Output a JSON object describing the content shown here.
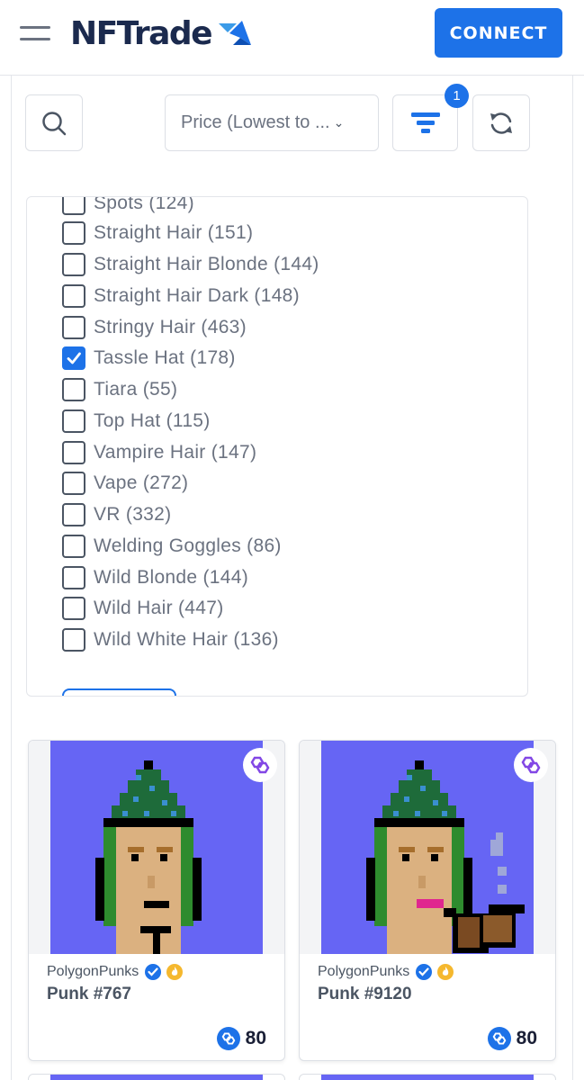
{
  "header": {
    "logo_text": "NFTrade",
    "connect_label": "CONNECT"
  },
  "toolbar": {
    "sort_label": "Price (Lowest to ...",
    "filter_badge": "1"
  },
  "filters": [
    {
      "label": "Spots (124)",
      "checked": false
    },
    {
      "label": "Straight Hair (151)",
      "checked": false
    },
    {
      "label": "Straight Hair Blonde (144)",
      "checked": false
    },
    {
      "label": "Straight Hair Dark (148)",
      "checked": false
    },
    {
      "label": "Stringy Hair (463)",
      "checked": false
    },
    {
      "label": "Tassle Hat (178)",
      "checked": true
    },
    {
      "label": "Tiara (55)",
      "checked": false
    },
    {
      "label": "Top Hat (115)",
      "checked": false
    },
    {
      "label": "Vampire Hair (147)",
      "checked": false
    },
    {
      "label": "Vape (272)",
      "checked": false
    },
    {
      "label": "VR (332)",
      "checked": false
    },
    {
      "label": "Welding Goggles (86)",
      "checked": false
    },
    {
      "label": "Wild Blonde (144)",
      "checked": false
    },
    {
      "label": "Wild Hair (447)",
      "checked": false
    },
    {
      "label": "Wild White Hair (136)",
      "checked": false
    }
  ],
  "cards": [
    {
      "collection": "PolygonPunks",
      "name": "Punk #767",
      "price": "80"
    },
    {
      "collection": "PolygonPunks",
      "name": "Punk #9120",
      "price": "80"
    }
  ],
  "colors": {
    "accent": "#1d72e8",
    "card_bg": "#6665f4",
    "polygon": "#8247e5"
  },
  "icons": {
    "menu": "hamburger-icon",
    "search": "search-icon",
    "filter": "filter-icon",
    "refresh": "refresh-icon",
    "chain": "polygon-icon",
    "verified": "verified-badge-icon",
    "hot": "flame-icon"
  }
}
